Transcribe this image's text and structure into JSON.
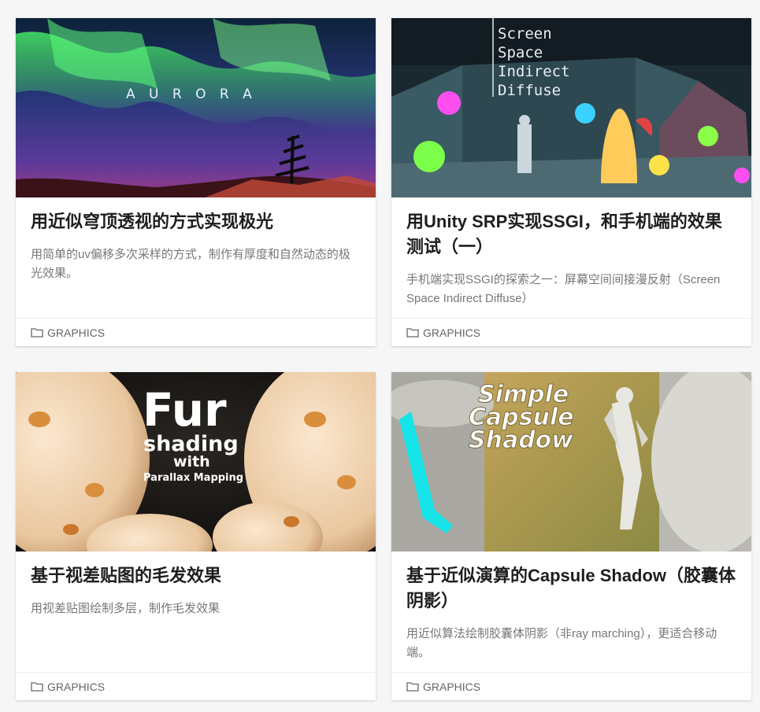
{
  "posts": [
    {
      "title": "用近似穹顶透视的方式实现极光",
      "excerpt": "用简单的uv偏移多次采样的方式，制作有厚度和自然动态的极光效果。",
      "category": "GRAPHICS",
      "thumb_text": "A U R O R A"
    },
    {
      "title": "用Unity SRP实现SSGI，和手机端的效果测试（一）",
      "excerpt": "手机端实现SSGI的探索之一：屏幕空间间接漫反射（Screen Space Indirect Diffuse）",
      "category": "GRAPHICS",
      "thumb_lines": [
        "Screen",
        "Space",
        "Indirect",
        "Diffuse"
      ]
    },
    {
      "title": "基于视差贴图的毛发效果",
      "excerpt": "用视差贴图绘制多层，制作毛发效果",
      "category": "GRAPHICS",
      "thumb_lines": [
        "Fur",
        "shading",
        "with",
        "Parallax Mapping"
      ]
    },
    {
      "title": "基于近似演算的Capsule Shadow（胶囊体阴影）",
      "excerpt": "用近似算法绘制胶囊体阴影（非ray marching），更适合移动端。",
      "category": "GRAPHICS",
      "thumb_lines": [
        "Simple",
        "Capsule",
        "Shadow"
      ]
    }
  ],
  "icons": {
    "category": "folder-icon"
  },
  "colors": {
    "title": "#1e1e1e",
    "excerpt": "#777777",
    "meta": "#666666",
    "page_bg": "#f6f6f6"
  }
}
